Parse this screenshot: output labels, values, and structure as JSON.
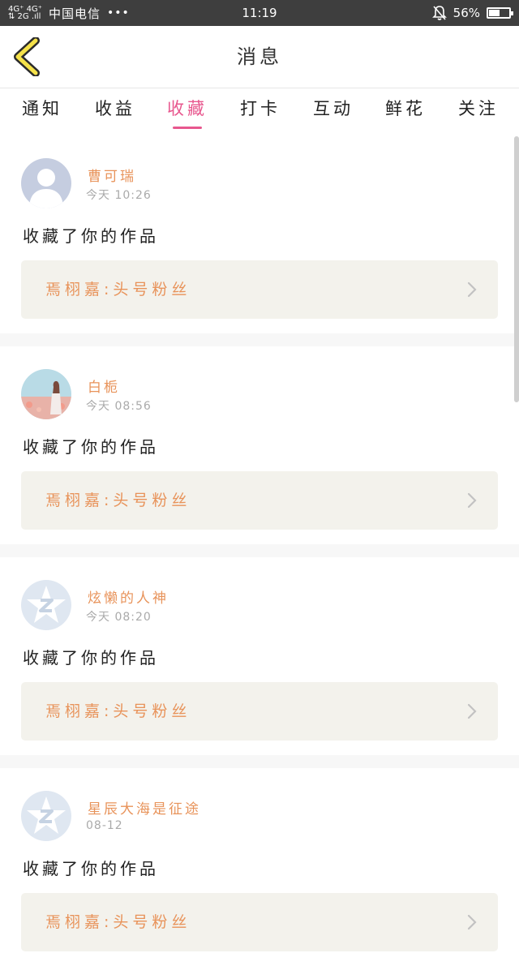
{
  "status_bar": {
    "network_top": "4G⁺ 4G⁺",
    "network_bottom": "⇅ 2G .ıll",
    "carrier": "中国电信",
    "more": "•••",
    "time": "11:19",
    "battery_percent": "56%",
    "battery_level": 0.56,
    "icons": [
      "signal-icon",
      "silent-bell-icon",
      "battery-icon"
    ]
  },
  "header": {
    "title": "消息",
    "back_icon": "back-chevron-icon"
  },
  "tabs": [
    {
      "label": "通知"
    },
    {
      "label": "收益"
    },
    {
      "label": "收藏",
      "active": true
    },
    {
      "label": "打卡"
    },
    {
      "label": "互动"
    },
    {
      "label": "鲜花"
    },
    {
      "label": "关注"
    }
  ],
  "messages": [
    {
      "user": "曹可瑞",
      "time": "今天 10:26",
      "action": "收藏了你的作品",
      "work": "焉栩嘉:头号粉丝",
      "avatar": "default-person-avatar"
    },
    {
      "user": "白栀",
      "time": "今天 08:56",
      "action": "收藏了你的作品",
      "work": "焉栩嘉:头号粉丝",
      "avatar": "photo-avatar"
    },
    {
      "user": "炫懒的人神",
      "time": "今天 08:20",
      "action": "收藏了你的作品",
      "work": "焉栩嘉:头号粉丝",
      "avatar": "qzone-star-avatar"
    },
    {
      "user": "星辰大海是征途",
      "time": "08-12",
      "action": "收藏了你的作品",
      "work": "焉栩嘉:头号粉丝",
      "avatar": "qzone-star-avatar"
    }
  ],
  "colors": {
    "accent_pink": "#e8578e",
    "username_orange": "#e8935a",
    "card_gray": "#f3f2ec",
    "status_bar": "#3e3e3e"
  }
}
